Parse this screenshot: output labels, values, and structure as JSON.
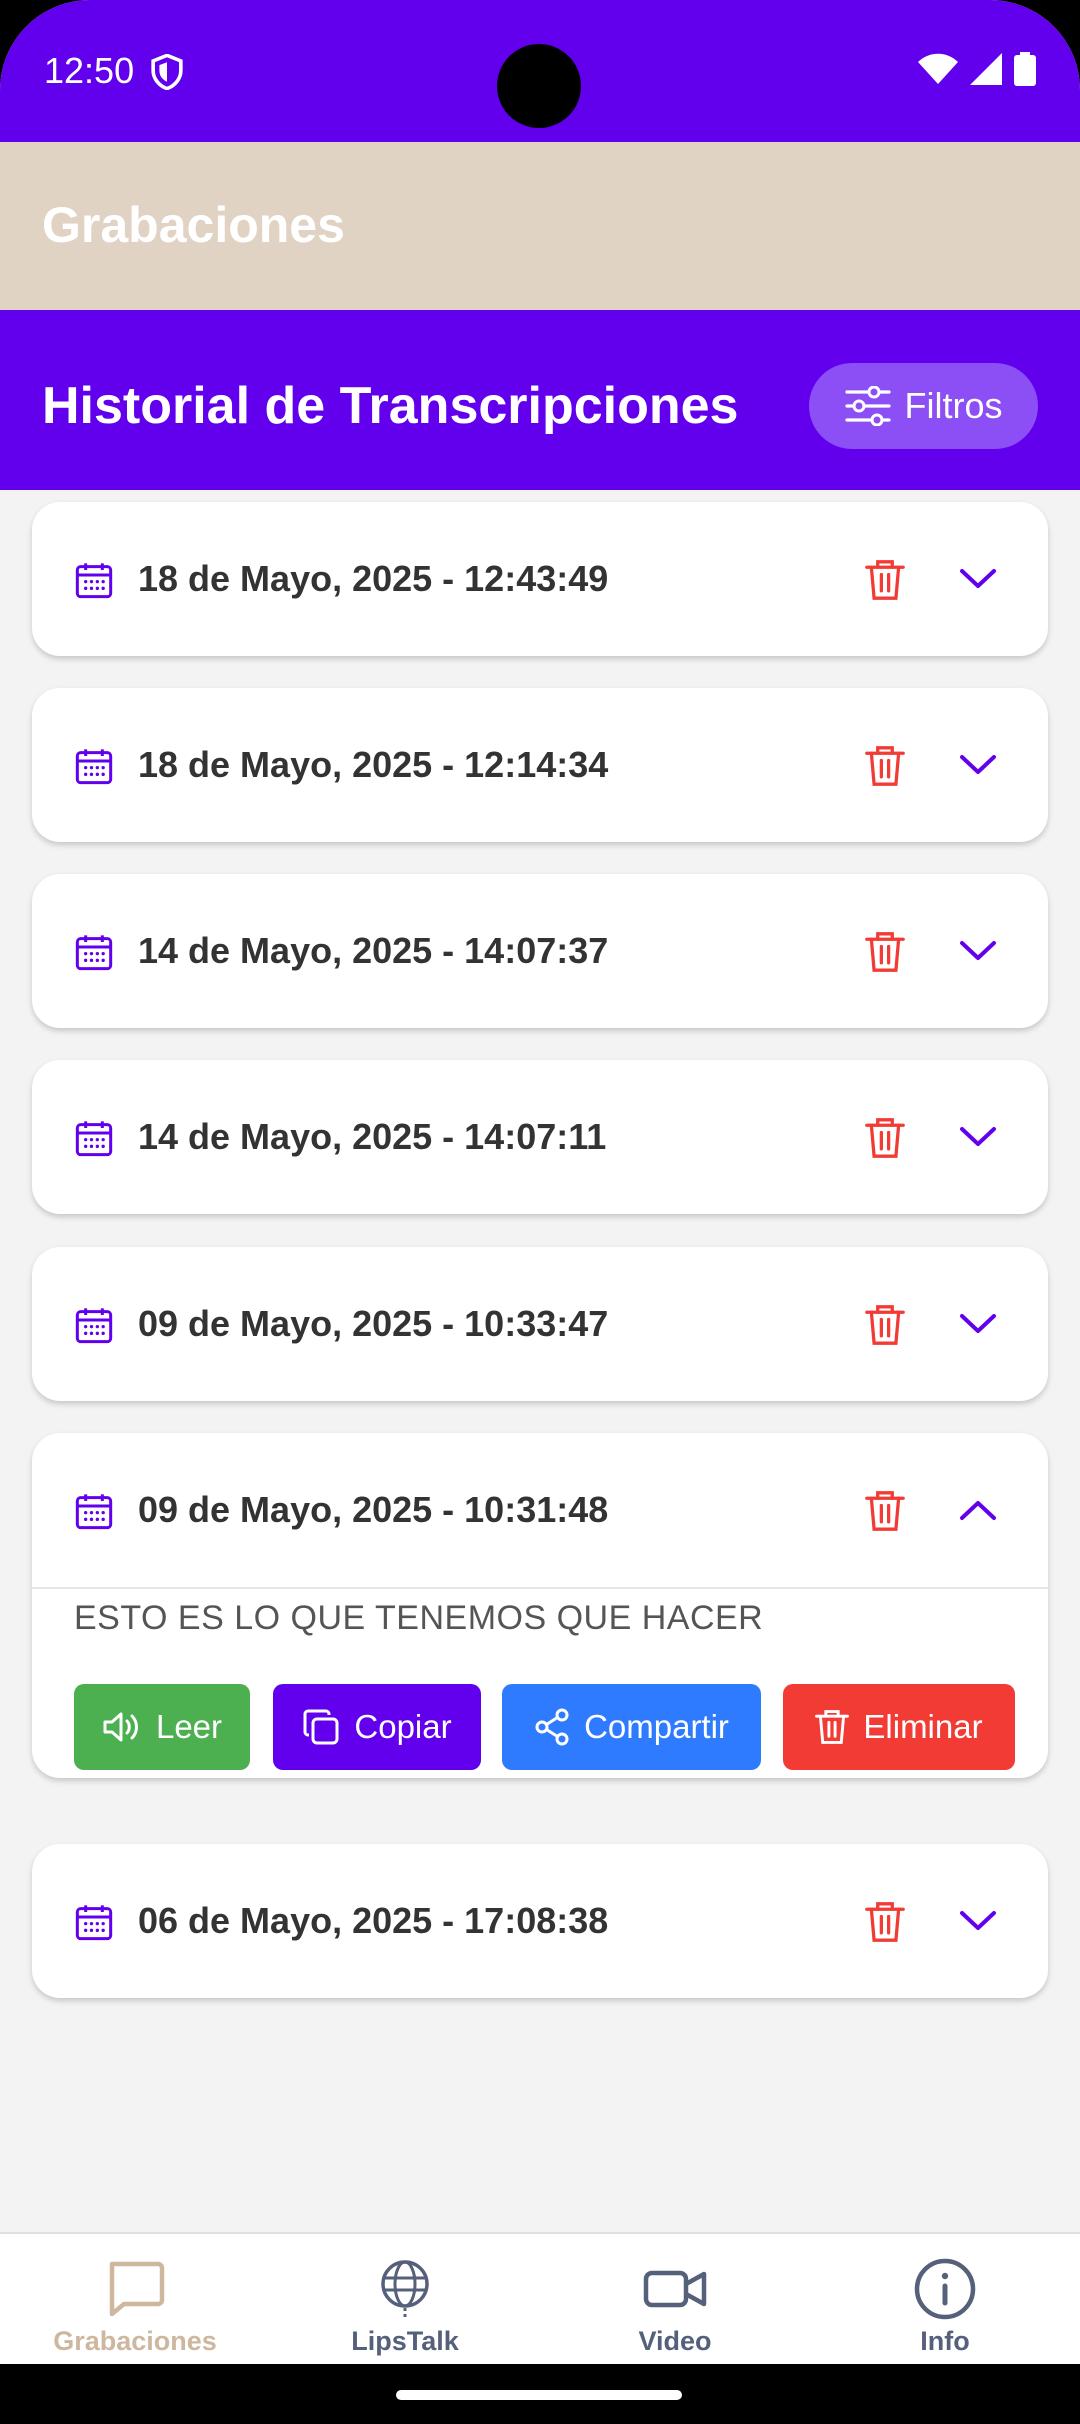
{
  "status_bar": {
    "time": "12:50"
  },
  "app_bar": {
    "title": "Grabaciones"
  },
  "header": {
    "title": "Historial de Transcripciones",
    "filters_label": "Filtros"
  },
  "recordings": [
    {
      "date": "18 de Mayo, 2025 - 12:43:49",
      "expanded": false
    },
    {
      "date": "18 de Mayo, 2025 - 12:14:34",
      "expanded": false
    },
    {
      "date": "14 de Mayo, 2025 - 14:07:37",
      "expanded": false
    },
    {
      "date": "14 de Mayo, 2025 - 14:07:11",
      "expanded": false
    },
    {
      "date": "09 de Mayo, 2025 - 10:33:47",
      "expanded": false
    },
    {
      "date": "09 de Mayo, 2025 - 10:31:48",
      "expanded": true,
      "text": "ESTO ES LO QUE TENEMOS QUE HACER"
    },
    {
      "date": "06 de Mayo, 2025 - 17:08:38",
      "expanded": false
    }
  ],
  "actions": {
    "read": "Leer",
    "copy": "Copiar",
    "share": "Compartir",
    "delete": "Eliminar"
  },
  "bottom_nav": [
    {
      "label": "Grabaciones",
      "icon": "chat-icon",
      "active": true
    },
    {
      "label": "LipsTalk",
      "icon": "globe-icon",
      "active": false
    },
    {
      "label": "Video",
      "icon": "video-icon",
      "active": false
    },
    {
      "label": "Info",
      "icon": "info-icon",
      "active": false
    }
  ],
  "colors": {
    "primary": "#6200ee",
    "app_bar": "#e1d3c3",
    "delete": "#f23b35",
    "read": "#4caf50",
    "share": "#2f7bff"
  }
}
